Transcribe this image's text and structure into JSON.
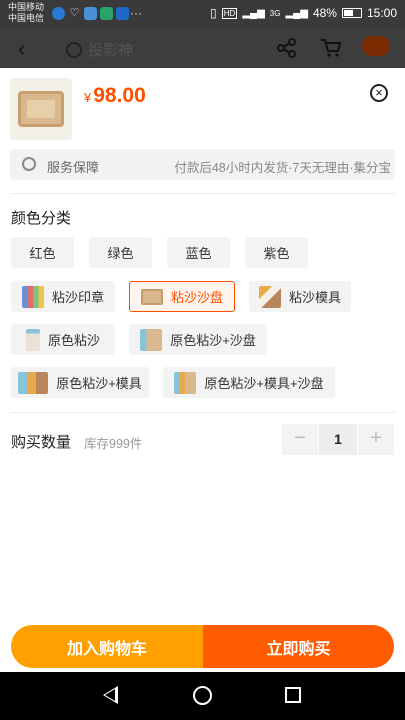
{
  "status_bar": {
    "carrier_1": "中国移动",
    "carrier_2": "中国电信",
    "signal_1": "3G",
    "battery": "48%",
    "time": "15:00",
    "more": "···"
  },
  "background_page": {
    "search_text": "投影神"
  },
  "product": {
    "currency": "¥",
    "price": "98.00"
  },
  "service": {
    "label": "服务保障",
    "value": "付款后48小时内发货·7天无理由·集分宝"
  },
  "color_section": {
    "title": "颜色分类",
    "options": [
      {
        "label": "红色",
        "selected": false
      },
      {
        "label": "绿色",
        "selected": false
      },
      {
        "label": "蓝色",
        "selected": false
      },
      {
        "label": "紫色",
        "selected": false
      },
      {
        "label": "粘沙印章",
        "selected": false,
        "icon": "stamp-set-icon"
      },
      {
        "label": "粘沙沙盘",
        "selected": true,
        "icon": "sand-tray-icon"
      },
      {
        "label": "粘沙模具",
        "selected": false,
        "icon": "mold-set-icon"
      },
      {
        "label": "原色粘沙",
        "selected": false,
        "icon": "sand-bottle-icon"
      },
      {
        "label": "原色粘沙+沙盘",
        "selected": false,
        "icon": "sand-tray-combo-icon"
      },
      {
        "label": "原色粘沙+模具",
        "selected": false,
        "icon": "sand-mold-combo-icon"
      },
      {
        "label": "原色粘沙+模具+沙盘",
        "selected": false,
        "icon": "full-combo-icon"
      }
    ]
  },
  "quantity": {
    "title": "购买数量",
    "stock": "库存999件",
    "value": "1",
    "minus": "−",
    "plus": "+"
  },
  "actions": {
    "add_to_cart": "加入购物车",
    "buy_now": "立即购买"
  },
  "colors": {
    "price": "#ff5000",
    "cart_button": "#ffa000",
    "buy_button": "#ff5b00"
  }
}
